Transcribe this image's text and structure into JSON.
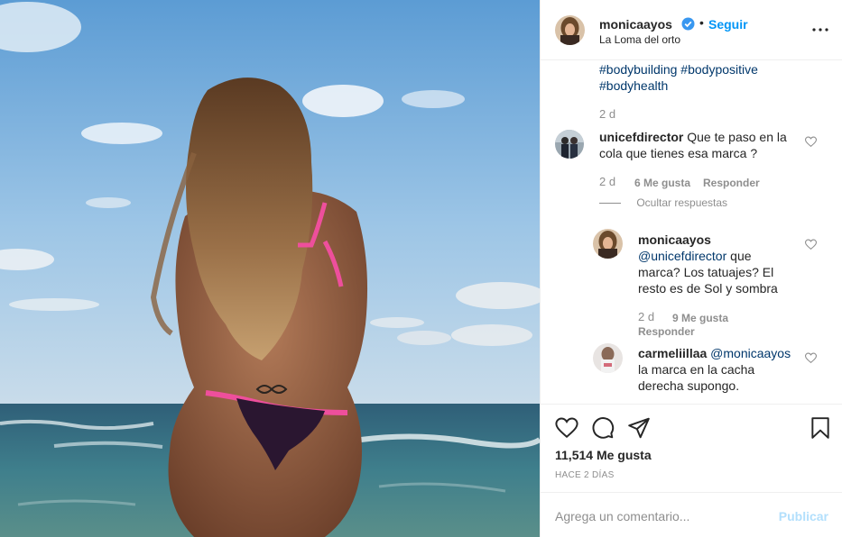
{
  "post": {
    "username": "monicaayos",
    "follow_label": "Seguir",
    "separator": "•",
    "location": "La Loma del orto",
    "photo_alt": "photo",
    "caption_tail": "#bodybuilding #bodypositive #bodyhealth",
    "caption_age": "2 d"
  },
  "comments": [
    {
      "username": "unicefdirector",
      "text": "Que te paso en la cola que tienes esa marca ?",
      "age": "2 d",
      "likes": "6 Me gusta",
      "reply_label": "Responder",
      "hide_replies_label": "Ocultar respuestas"
    }
  ],
  "replies": [
    {
      "username": "monicaayos",
      "mention": "@unicefdirector",
      "text": "que marca? Los tatuajes? El resto es de Sol y sombra",
      "age": "2 d",
      "likes": "9 Me gusta",
      "reply_label": "Responder"
    },
    {
      "username": "carmeliillaa",
      "mention": "@monicaayos",
      "text": "la marca en la cacha derecha supongo."
    }
  ],
  "actions": {
    "likes_count": "11,514 Me gusta",
    "date": "HACE 2 DÍAS"
  },
  "composer": {
    "placeholder": "Agrega un comentario...",
    "publish_label": "Publicar"
  },
  "icons": {
    "verified": "verified-badge-icon",
    "more": "more-options-icon",
    "like": "heart-icon",
    "comment": "comment-bubble-icon",
    "share": "paper-plane-icon",
    "save": "bookmark-icon"
  },
  "colors": {
    "link": "#00376b",
    "accent": "#0095f6",
    "muted": "#8e8e8e",
    "publish_disabled": "#b2dffc"
  }
}
